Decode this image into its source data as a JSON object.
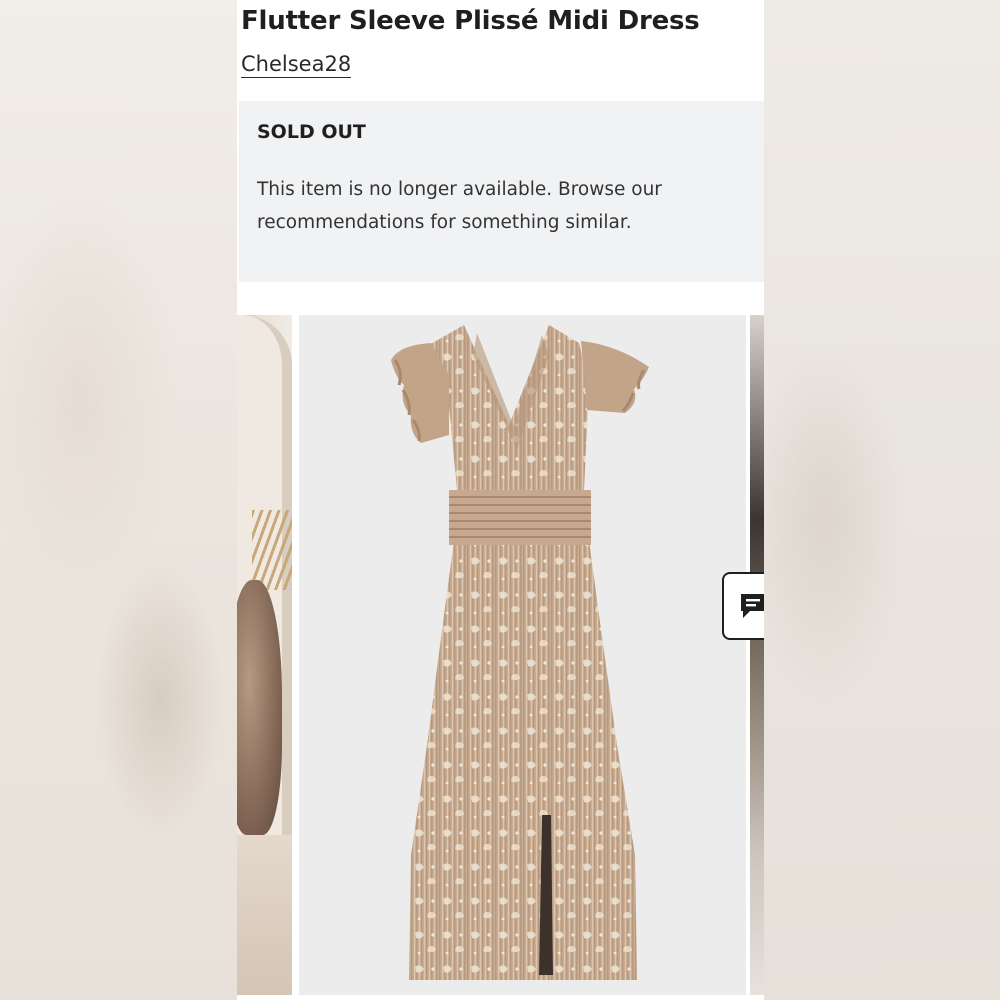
{
  "product": {
    "title": "Flutter Sleeve Plissé Midi Dress",
    "brand": "Chelsea28"
  },
  "availability": {
    "status_label": "SOLD OUT",
    "message": "This item is no longer available. Browse our recommendations for something similar."
  },
  "gallery": {
    "images": [
      {
        "name": "styled-photo-thumbnail"
      },
      {
        "name": "product-photo-dress"
      },
      {
        "name": "model-photo-thumbnail"
      }
    ]
  },
  "chat": {
    "icon": "chat-icon"
  },
  "colors": {
    "dress": "#c9ad92",
    "panel_bg": "#ffffff",
    "soldout_bg": "#f1f2f4",
    "text": "#1f1f1f"
  }
}
